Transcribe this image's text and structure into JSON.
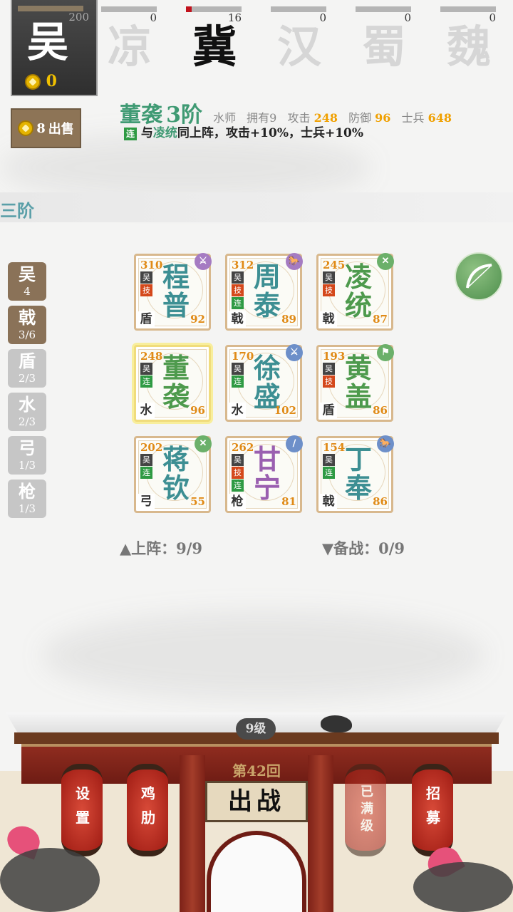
{
  "player_faction": {
    "name": "吴",
    "score": "200",
    "gold": "0"
  },
  "factions": [
    {
      "name": "凉",
      "count": "0",
      "progress": 0,
      "active": false
    },
    {
      "name": "冀",
      "count": "16",
      "progress": 0.1,
      "active": true
    },
    {
      "name": "汉",
      "count": "0",
      "progress": 0,
      "active": false
    },
    {
      "name": "蜀",
      "count": "0",
      "progress": 0,
      "active": false
    },
    {
      "name": "魏",
      "count": "0",
      "progress": 0,
      "active": false
    }
  ],
  "sell_button": {
    "price": "8",
    "label": "出售"
  },
  "selected_hero": {
    "name": "董袭",
    "rank": "3阶",
    "role": "水师",
    "owned": "拥有9",
    "attack_label": "攻击",
    "attack": "248",
    "defense_label": "防御",
    "defense": "96",
    "soldier_label": "士兵",
    "soldier": "648",
    "bond_tag": "连",
    "bond_text_pre": "与",
    "bond_partner": "凌统",
    "bond_text_post": "同上阵，攻击+10%，士兵+10%"
  },
  "section_title": "三阶",
  "filters": [
    {
      "label": "吴",
      "count": "4",
      "on": true
    },
    {
      "label": "戟",
      "count": "3/6",
      "on": true
    },
    {
      "label": "盾",
      "count": "2/3",
      "on": false
    },
    {
      "label": "水",
      "count": "2/3",
      "on": false
    },
    {
      "label": "弓",
      "count": "1/3",
      "on": false
    },
    {
      "label": "枪",
      "count": "1/3",
      "on": false
    }
  ],
  "heroes": [
    {
      "name1": "程",
      "name2": "普",
      "hp": "310",
      "type": "盾",
      "power": "92",
      "tags": [
        "吴",
        "技"
      ],
      "color": "#3d8f93",
      "badge_color": "#a57bc2",
      "badge": "⚔",
      "selected": false
    },
    {
      "name1": "周",
      "name2": "泰",
      "hp": "312",
      "type": "戟",
      "power": "89",
      "tags": [
        "吴",
        "技",
        "连"
      ],
      "color": "#3d8f93",
      "badge_color": "#a57bc2",
      "badge": "🐎",
      "selected": false
    },
    {
      "name1": "凌",
      "name2": "统",
      "hp": "245",
      "type": "戟",
      "power": "87",
      "tags": [
        "吴",
        "技"
      ],
      "color": "#4e9a4d",
      "badge_color": "#6bb06a",
      "badge": "✕",
      "selected": false
    },
    {
      "name1": "董",
      "name2": "袭",
      "hp": "248",
      "type": "水",
      "power": "96",
      "tags": [
        "吴",
        "连"
      ],
      "color": "#4e9a4d",
      "badge_color": "",
      "badge": "",
      "selected": true
    },
    {
      "name1": "徐",
      "name2": "盛",
      "hp": "170",
      "type": "水",
      "power": "102",
      "tags": [
        "吴",
        "连"
      ],
      "color": "#3d8f93",
      "badge_color": "#6d8fc9",
      "badge": "⚔",
      "selected": false
    },
    {
      "name1": "黄",
      "name2": "盖",
      "hp": "193",
      "type": "盾",
      "power": "86",
      "tags": [
        "吴",
        "技"
      ],
      "color": "#4e9a4d",
      "badge_color": "#6bb06a",
      "badge": "⚑",
      "selected": false
    },
    {
      "name1": "蒋",
      "name2": "钦",
      "hp": "202",
      "type": "弓",
      "power": "55",
      "tags": [
        "吴",
        "连"
      ],
      "color": "#3d8f93",
      "badge_color": "#6bb06a",
      "badge": "✕",
      "selected": false
    },
    {
      "name1": "甘",
      "name2": "宁",
      "hp": "262",
      "type": "枪",
      "power": "81",
      "tags": [
        "吴",
        "技",
        "连"
      ],
      "color": "#9a5fb0",
      "badge_color": "#6d8fc9",
      "badge": "∕",
      "selected": false
    },
    {
      "name1": "丁",
      "name2": "奉",
      "hp": "154",
      "type": "戟",
      "power": "86",
      "tags": [
        "吴",
        "连"
      ],
      "color": "#3d8f93",
      "badge_color": "#6d8fc9",
      "badge": "🐎",
      "selected": false
    }
  ],
  "deployed": {
    "label": "▲上阵：9/9"
  },
  "reserve": {
    "label": "▼备战：0/9"
  },
  "palace": {
    "level": "9级",
    "round": "第42回",
    "fight": "出战",
    "lanterns": [
      {
        "label": "设置",
        "dim": false
      },
      {
        "label": "鸡肋",
        "dim": false
      },
      {
        "label": "已满级",
        "dim": true
      },
      {
        "label": "招募",
        "dim": false
      }
    ]
  },
  "colors": {
    "accent_green": "#3f9a73",
    "gold": "#f0a000",
    "brown": "#8a7258"
  }
}
